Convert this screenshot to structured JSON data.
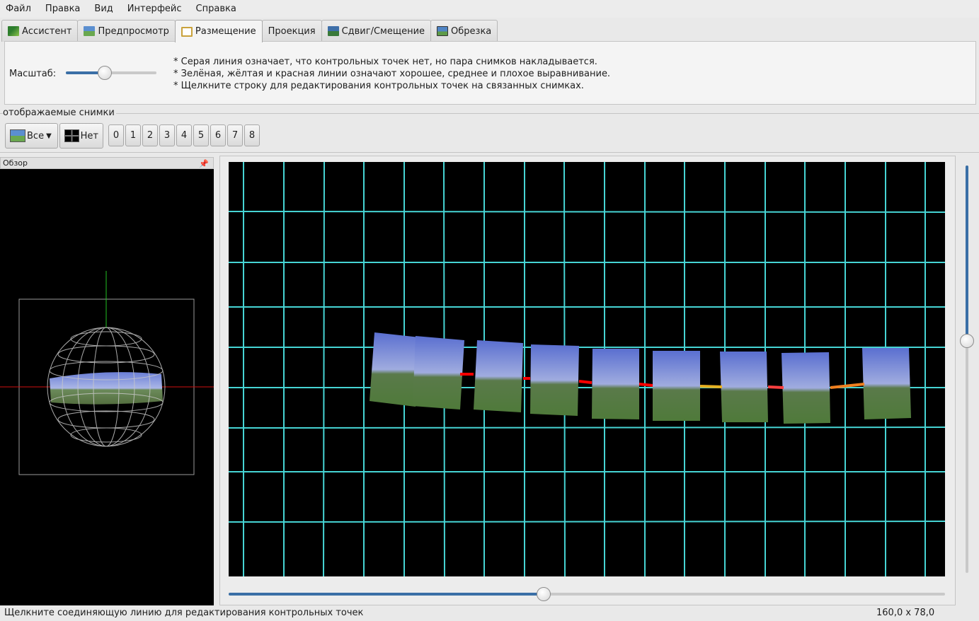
{
  "menu": [
    "Файл",
    "Правка",
    "Вид",
    "Интерфейс",
    "Справка"
  ],
  "tabs": [
    {
      "label": "Ассистент",
      "icon": "assistant-icon",
      "color": "#3a8f3a"
    },
    {
      "label": "Предпросмотр",
      "icon": "preview-icon",
      "color": "#4f84c4"
    },
    {
      "label": "Размещение",
      "icon": "layout-icon",
      "color": "#c9a23c"
    },
    {
      "label": "Проекция",
      "icon": "",
      "color": ""
    },
    {
      "label": "Сдвиг/Смещение",
      "icon": "move-drag-icon",
      "color": "#3a7a3a"
    },
    {
      "label": "Обрезка",
      "icon": "crop-icon",
      "color": "#4f84c4"
    }
  ],
  "active_tab": 2,
  "scale": {
    "label": "Масштаб:",
    "value_fraction": 0.43
  },
  "hints": [
    "* Серая линия означает, что контрольных точек нет, но пара снимков накладывается.",
    "* Зелёная, жёлтая и красная линии означают  хорошее, среднее и плохое выравнивание.",
    "* Щелкните строку для редактирования контрольных точек на связанных снимках."
  ],
  "displayed_images": {
    "title": "отображаемые снимки",
    "all_label": "Все",
    "none_label": "Нет",
    "numbers": [
      "0",
      "1",
      "2",
      "3",
      "4",
      "5",
      "6",
      "7",
      "8"
    ]
  },
  "overview": {
    "title": "Обзор"
  },
  "links": [
    {
      "from": 1,
      "to": 2,
      "color": "#ff0000"
    },
    {
      "from": 2,
      "to": 3,
      "color": "#ff0000"
    },
    {
      "from": 3,
      "to": 4,
      "color": "#ff0000"
    },
    {
      "from": 4,
      "to": 5,
      "color": "#ff0000"
    },
    {
      "from": 5,
      "to": 6,
      "color": "#e8b020"
    },
    {
      "from": 6,
      "to": 7,
      "color": "#ff4040"
    },
    {
      "from": 7,
      "to": 8,
      "color": "#f08020"
    }
  ],
  "horizontal_slider_fraction": 0.44,
  "vertical_slider_fraction": 0.43,
  "status": "Щелкните соединяющую линию для редактирования контрольных точек",
  "coords": "160,0 x 78,0"
}
